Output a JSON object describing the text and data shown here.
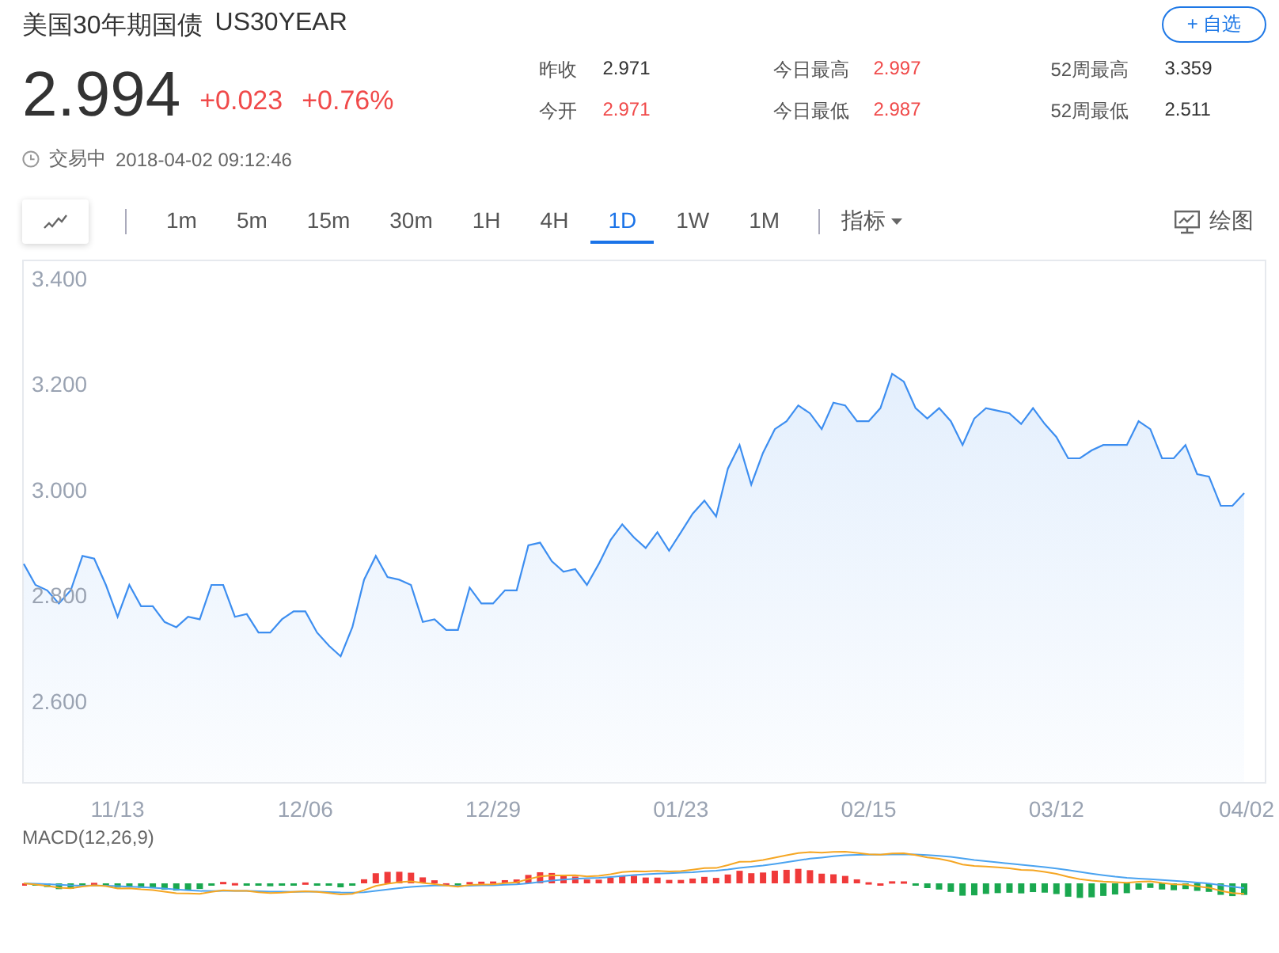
{
  "header": {
    "name": "美国30年期国债",
    "symbol": "US30YEAR",
    "watch_button": "+ 自选"
  },
  "quote": {
    "price": "2.994",
    "change": "+0.023",
    "change_pct": "+0.76%",
    "rising": true
  },
  "stats": [
    {
      "label": "昨收",
      "value": "2.971",
      "rising": false
    },
    {
      "label": "今日最高",
      "value": "2.997",
      "rising": true
    },
    {
      "label": "52周最高",
      "value": "3.359",
      "rising": false
    },
    {
      "label": "今开",
      "value": "2.971",
      "rising": true
    },
    {
      "label": "今日最低",
      "value": "2.987",
      "rising": true
    },
    {
      "label": "52周最低",
      "value": "2.511",
      "rising": false
    }
  ],
  "status": {
    "state": "交易中",
    "time": "2018-04-02 09:12:46"
  },
  "toolbar": {
    "intervals": [
      {
        "label": "1m",
        "selected": false
      },
      {
        "label": "5m",
        "selected": false
      },
      {
        "label": "15m",
        "selected": false
      },
      {
        "label": "30m",
        "selected": false
      },
      {
        "label": "1H",
        "selected": false
      },
      {
        "label": "4H",
        "selected": false
      },
      {
        "label": "1D",
        "selected": true
      },
      {
        "label": "1W",
        "selected": false
      },
      {
        "label": "1M",
        "selected": false
      }
    ],
    "indicator_menu": "指标",
    "draw_button": "绘图"
  },
  "chart": {
    "chart_data": {
      "type": "area",
      "ylim": [
        2.447,
        3.436
      ],
      "categories": [
        null,
        null,
        null,
        null,
        null,
        null,
        null,
        null,
        "11/13",
        null,
        null,
        null,
        null,
        null,
        null,
        null,
        null,
        null,
        null,
        null,
        null,
        null,
        null,
        null,
        "12/06",
        null,
        null,
        null,
        null,
        null,
        null,
        null,
        null,
        null,
        null,
        null,
        null,
        null,
        null,
        null,
        "12/29",
        null,
        null,
        null,
        null,
        null,
        null,
        null,
        null,
        null,
        null,
        null,
        null,
        null,
        null,
        null,
        "01/23",
        null,
        null,
        null,
        null,
        null,
        null,
        null,
        null,
        null,
        null,
        null,
        null,
        null,
        null,
        null,
        "02/15",
        null,
        null,
        null,
        null,
        null,
        null,
        null,
        null,
        null,
        null,
        null,
        null,
        null,
        null,
        null,
        "03/12",
        null,
        null,
        null,
        null,
        null,
        null,
        null,
        null,
        null,
        null,
        null,
        null,
        null,
        null,
        null,
        "04/02"
      ],
      "yticks": [
        {
          "value": 3.4,
          "label": "3.400"
        },
        {
          "value": 3.2,
          "label": "3.200"
        },
        {
          "value": 3.0,
          "label": "3.000"
        },
        {
          "value": 2.8,
          "label": "2.800"
        },
        {
          "value": 2.6,
          "label": "2.600"
        }
      ],
      "series": [
        {
          "color": "#3d8ef0",
          "values": [
            2.86,
            2.82,
            2.81,
            2.785,
            2.81,
            2.875,
            2.87,
            2.82,
            2.76,
            2.82,
            2.78,
            2.78,
            2.75,
            2.74,
            2.76,
            2.755,
            2.82,
            2.82,
            2.76,
            2.765,
            2.73,
            2.73,
            2.755,
            2.77,
            2.77,
            2.73,
            2.705,
            2.685,
            2.74,
            2.83,
            2.875,
            2.835,
            2.83,
            2.82,
            2.75,
            2.755,
            2.735,
            2.735,
            2.815,
            2.785,
            2.785,
            2.81,
            2.81,
            2.895,
            2.9,
            2.865,
            2.845,
            2.85,
            2.82,
            2.86,
            2.905,
            2.935,
            2.91,
            2.89,
            2.92,
            2.885,
            2.92,
            2.955,
            2.98,
            2.95,
            3.04,
            3.085,
            3.01,
            3.07,
            3.115,
            3.13,
            3.16,
            3.145,
            3.115,
            3.165,
            3.16,
            3.13,
            3.13,
            3.155,
            3.22,
            3.205,
            3.155,
            3.135,
            3.155,
            3.13,
            3.085,
            3.135,
            3.155,
            3.15,
            3.145,
            3.125,
            3.155,
            3.125,
            3.1,
            3.06,
            3.06,
            3.075,
            3.085,
            3.085,
            3.085,
            3.13,
            3.115,
            3.06,
            3.06,
            3.085,
            3.03,
            3.025,
            2.97,
            2.97,
            2.994
          ]
        }
      ]
    }
  },
  "macd": {
    "title": "MACD(12,26,9)"
  }
}
